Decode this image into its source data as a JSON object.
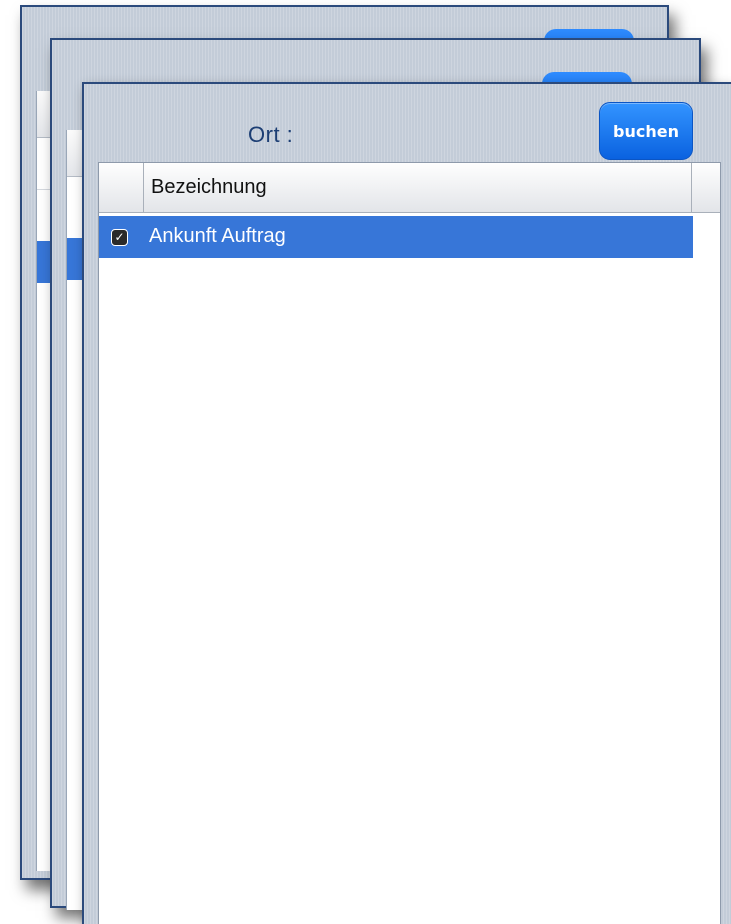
{
  "window": {
    "location_label": "Ort :",
    "book_button_label": "buchen"
  },
  "list": {
    "columns": [
      "Bezeichnung"
    ],
    "rows": [
      {
        "label": "Ankunft Auftrag",
        "checked": true,
        "selected": true,
        "check_icon": "checkmark-icon"
      }
    ]
  },
  "colors": {
    "accent": "#0a62e0",
    "selection": "#3776d8",
    "window_bg": "#c3ccd8",
    "window_border": "#2b4a7c",
    "title_text": "#1c3e74"
  }
}
